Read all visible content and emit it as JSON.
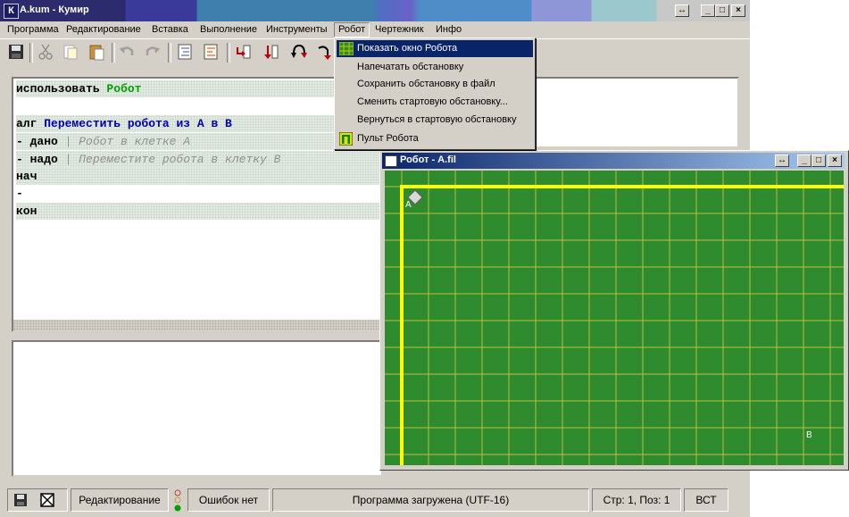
{
  "window": {
    "title": "A.kum - Кумир",
    "icon_letter": "К"
  },
  "caption_buttons": {
    "resize": "↔",
    "minimize": "_",
    "maximize": "□",
    "close": "×"
  },
  "menubar": [
    "Программа",
    "Редактирование",
    "Вставка",
    "Выполнение",
    "Инструменты",
    "Робот",
    "Чертежник",
    "Инфо"
  ],
  "editor": {
    "lines": [
      {
        "kw": "использовать ",
        "name": "Робот"
      },
      {
        "text": ""
      },
      {
        "kw": "алг ",
        "name": "Переместить робота из А в В"
      },
      {
        "kw": "- дано ",
        "comment": "| Робот в клетке А"
      },
      {
        "kw": "- надо ",
        "comment": "| Переместите робота в клетку В"
      },
      {
        "kw": "нач"
      },
      {
        "kw": "-"
      },
      {
        "kw": "кон"
      }
    ]
  },
  "dropdown": {
    "items": [
      {
        "label": "Показать окно Робота",
        "icon": "robot-grid-icon",
        "highlighted": true
      },
      {
        "label": "Напечатать обстановку"
      },
      {
        "label": "Сохранить обстановку в файл"
      },
      {
        "label": "Сменить стартовую обстановку..."
      },
      {
        "label": "Вернуться в стартовую обстановку"
      },
      {
        "label": "Пульт Робота",
        "icon": "robot-remote-icon"
      }
    ]
  },
  "robot_window": {
    "title": "Робот - A.fil",
    "field": {
      "cols": 18,
      "rows": 11,
      "start_label": "А",
      "end_label": "В",
      "bg": "#2e8b2e",
      "grid": "#b8c040",
      "wall": "#ffff00"
    }
  },
  "statusbar": {
    "mode": "Редактирование",
    "errors": "Ошибок нет",
    "message": "Программа загружена (UTF-16)",
    "position": "Стр: 1, Поз: 1",
    "insert": "ВСТ"
  },
  "colors": {
    "menu_highlight": "#0a246a",
    "keyword_blue": "#0000b0",
    "keyword_green": "#00a000"
  }
}
